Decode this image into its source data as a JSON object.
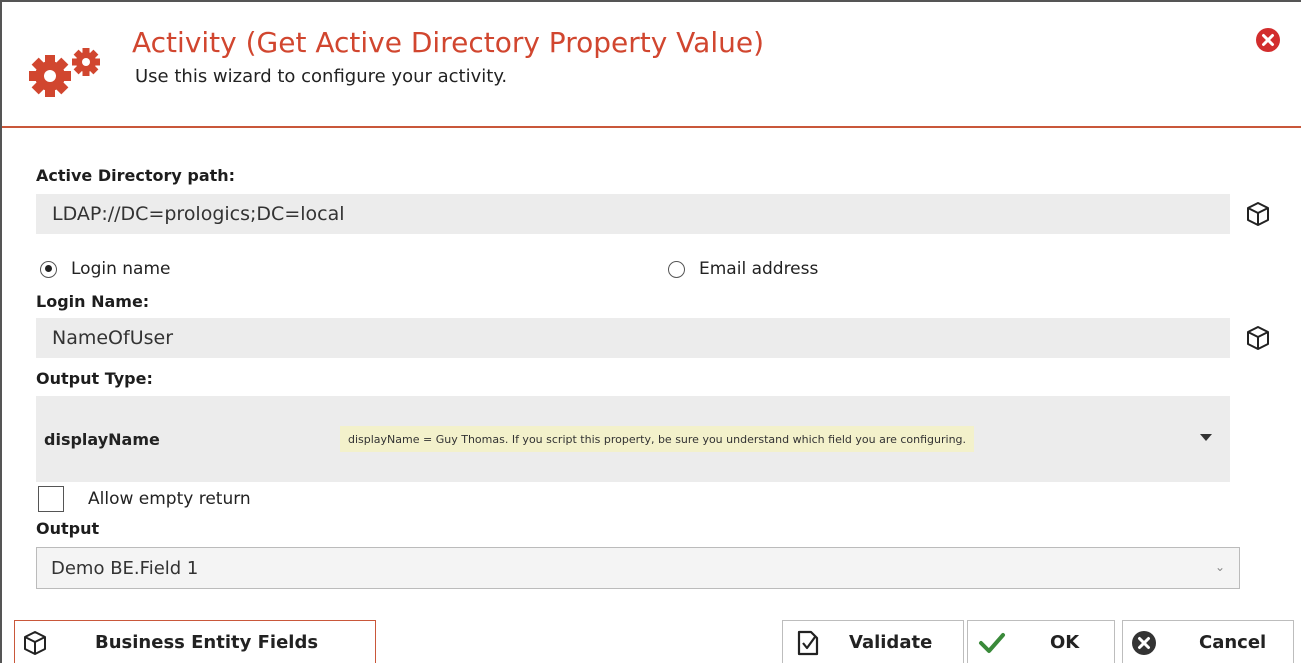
{
  "dialog": {
    "title": "Activity (Get Active Directory Property Value)",
    "subtitle": "Use this wizard to configure your activity.",
    "logo_icon": "gears-icon",
    "close_icon": "close-circle-icon",
    "accent_color": "#d1462f"
  },
  "ad_path": {
    "label": "Active Directory path:",
    "value": "LDAP://DC=prologics;DC=local",
    "picker_icon": "cube-icon"
  },
  "lookup_mode": {
    "options": [
      {
        "label": "Login name",
        "selected": true
      },
      {
        "label": "Email address",
        "selected": false
      }
    ]
  },
  "login_name": {
    "label": "Login Name:",
    "value": "NameOfUser",
    "picker_icon": "cube-icon"
  },
  "output_type": {
    "label": "Output Type:",
    "value": "displayName",
    "hint": "displayName = Guy Thomas.  If you script this property, be sure you understand which field you are configuring."
  },
  "allow_empty": {
    "label": "Allow empty return",
    "checked": false
  },
  "output": {
    "label": "Output",
    "selected": "Demo BE.Field 1"
  },
  "footer": {
    "business_entity_fields": "Business Entity Fields",
    "validate": "Validate",
    "ok": "OK",
    "cancel": "Cancel"
  }
}
